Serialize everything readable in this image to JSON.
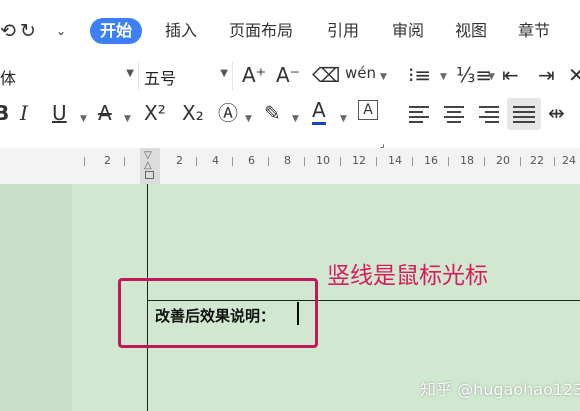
{
  "quick_access": {
    "redo_icon": "redo-icon",
    "more_icon": "chevron-down-icon"
  },
  "menu": {
    "tabs": [
      {
        "label": "开始",
        "active": true
      },
      {
        "label": "插入"
      },
      {
        "label": "页面布局"
      },
      {
        "label": "引用"
      },
      {
        "label": "审阅"
      },
      {
        "label": "视图"
      },
      {
        "label": "章节"
      }
    ]
  },
  "ribbon": {
    "font_name": "体",
    "font_size": "五号",
    "grow_font": "A⁺",
    "shrink_font": "A⁻",
    "pinyin": "wén",
    "superscript": "X²",
    "subscript": "X₂"
  },
  "ruler": {
    "labels": [
      "2",
      "2",
      "4",
      "6",
      "8",
      "10",
      "12",
      "14",
      "16",
      "18",
      "20",
      "22",
      "24"
    ]
  },
  "document": {
    "text": "改善后效果说明：",
    "annotation": "竖线是鼠标光标",
    "watermark": "知乎 @hugaohao123"
  },
  "colors": {
    "accent": "#3d7ff5",
    "annotation": "#d81b60",
    "canvas": "#cfe8cf"
  }
}
